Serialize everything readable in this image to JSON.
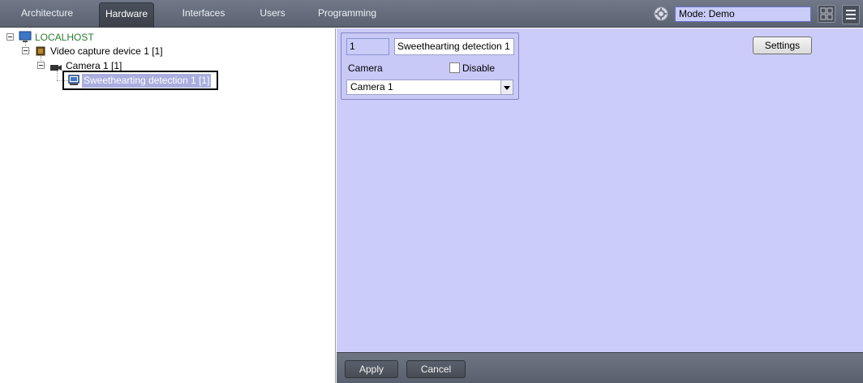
{
  "tabs": [
    {
      "label": "Architecture"
    },
    {
      "label": "Hardware"
    },
    {
      "label": "Interfaces"
    },
    {
      "label": "Users"
    },
    {
      "label": "Programming"
    }
  ],
  "active_tab": "Hardware",
  "mode": {
    "value": "Mode: Demo"
  },
  "tree": {
    "root": {
      "label": "LOCALHOST",
      "icon": "computer-icon"
    },
    "video_capture": {
      "label": "Video capture device 1 [1]",
      "icon": "chip-icon"
    },
    "camera": {
      "label": "Camera 1 [1]",
      "icon": "camera-icon"
    },
    "detection": {
      "label": "Sweethearting detection 1 [1]",
      "icon": "monitor-icon"
    }
  },
  "props": {
    "id": "1",
    "name": "Sweethearting detection 1",
    "camera_label": "Camera",
    "disable_label": "Disable",
    "disable_checked": false,
    "camera_selected": "Camera 1"
  },
  "buttons": {
    "settings": "Settings",
    "apply": "Apply",
    "cancel": "Cancel"
  },
  "colors": {
    "topbar": "#646c7b",
    "panel_bg": "#ccccfa",
    "selection": "#a9aede",
    "localhost_text": "#2b7a30"
  }
}
